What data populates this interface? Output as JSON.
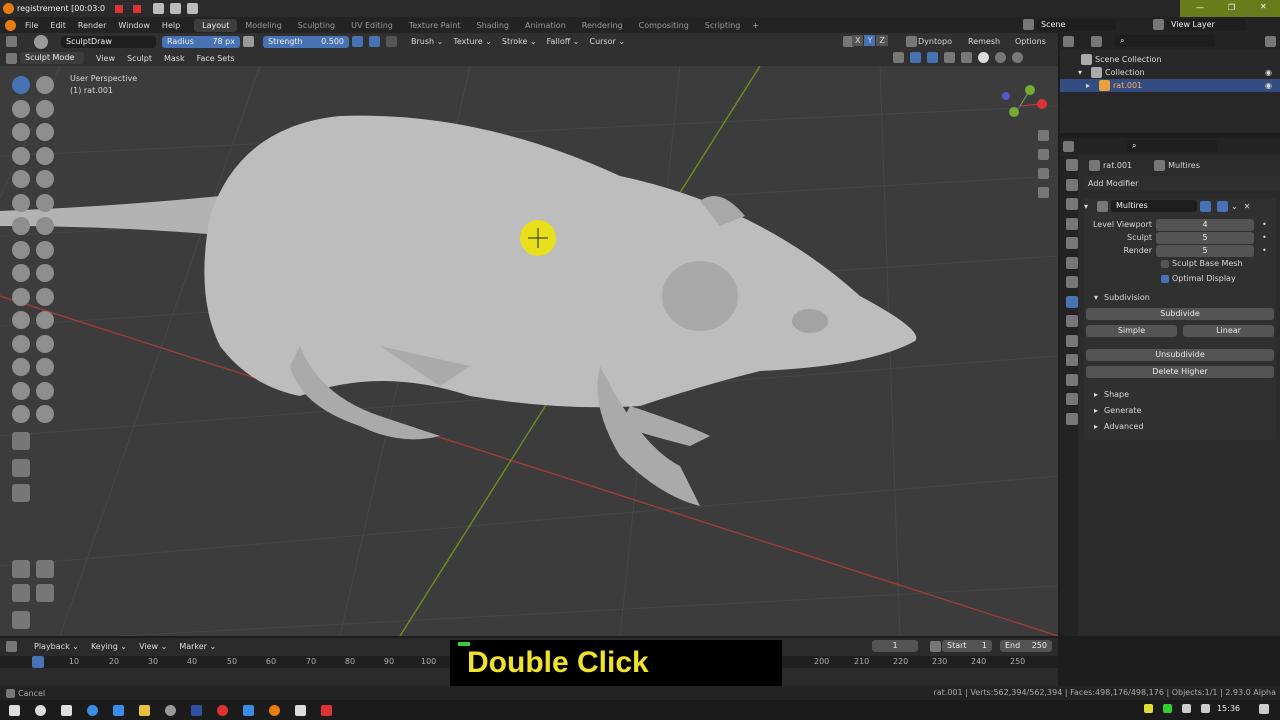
{
  "window": {
    "title": "registrement [00:03:0"
  },
  "menu": [
    "File",
    "Edit",
    "Render",
    "Window",
    "Help"
  ],
  "workspaces": [
    "Layout",
    "Modeling",
    "Sculpting",
    "UV Editing",
    "Texture Paint",
    "Shading",
    "Animation",
    "Rendering",
    "Compositing",
    "Scripting"
  ],
  "active_workspace": "Layout",
  "scene": {
    "name": "Scene",
    "view_layer": "View Layer"
  },
  "tool_header": {
    "brush": "SculptDraw",
    "radius_label": "Radius",
    "radius_value": "78 px",
    "strength_label": "Strength",
    "strength_value": "0.500",
    "menus": [
      "Brush",
      "Texture",
      "Stroke",
      "Falloff",
      "Cursor"
    ],
    "axes": [
      "X",
      "Y",
      "Z"
    ],
    "right": [
      "Dyntopo",
      "Remesh",
      "Options"
    ]
  },
  "mode_header": {
    "mode": "Sculpt Mode",
    "menus": [
      "View",
      "Sculpt",
      "Mask",
      "Face Sets"
    ]
  },
  "viewport": {
    "line1": "User Perspective",
    "line2": "(1) rat.001"
  },
  "outliner": {
    "root": "Scene Collection",
    "collection": "Collection",
    "object": "rat.001"
  },
  "properties": {
    "object": "rat.001",
    "modifier_tab": "Multires",
    "add_modifier": "Add Modifier",
    "modifier_name": "Multires",
    "fields": [
      {
        "label": "Level Viewport",
        "value": "4"
      },
      {
        "label": "Sculpt",
        "value": "5"
      },
      {
        "label": "Render",
        "value": "5"
      }
    ],
    "check_sculpt_base": "Sculpt Base Mesh",
    "check_optimal": "Optimal Display",
    "subdivision": "Subdivision",
    "subdivide": "Subdivide",
    "simple": "Simple",
    "linear": "Linear",
    "unsubdivide": "Unsubdivide",
    "delete_higher": "Delete Higher",
    "panels": [
      "Shape",
      "Generate",
      "Advanced"
    ]
  },
  "timeline": {
    "menus": [
      "Playback",
      "Keying",
      "View",
      "Marker"
    ],
    "current_frame": "1",
    "start_label": "Start",
    "start": "1",
    "end_label": "End",
    "end": "250",
    "ticks": [
      "1",
      "10",
      "20",
      "30",
      "40",
      "50",
      "60",
      "70",
      "80",
      "90",
      "100",
      "200",
      "210",
      "220",
      "230",
      "240",
      "250"
    ]
  },
  "overlay_caption": "Double Click",
  "status": {
    "left": "Cancel",
    "right": "rat.001 | Verts:562,394/562,394 | Faces:498,176/498,176 | Objects:1/1 | 2.93.0 Alpha"
  },
  "taskbar": {
    "time": "15:36"
  }
}
